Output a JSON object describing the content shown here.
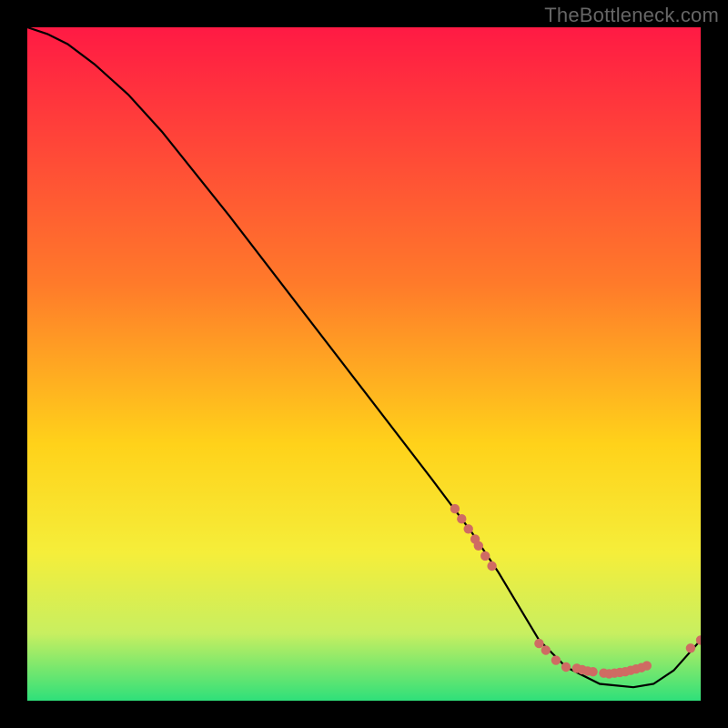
{
  "watermark": "TheBottleneck.com",
  "chart_data": {
    "type": "line",
    "title": "",
    "xlabel": "",
    "ylabel": "",
    "xlim": [
      0,
      100
    ],
    "ylim": [
      0,
      100
    ],
    "grid": false,
    "background_gradient": {
      "stops": [
        {
          "offset": 0.0,
          "color": "#ff1a44"
        },
        {
          "offset": 0.38,
          "color": "#ff7a2a"
        },
        {
          "offset": 0.62,
          "color": "#ffd21a"
        },
        {
          "offset": 0.78,
          "color": "#f5ee3a"
        },
        {
          "offset": 0.9,
          "color": "#c8ef60"
        },
        {
          "offset": 1.0,
          "color": "#2fe07a"
        }
      ]
    },
    "curve": {
      "x": [
        0,
        3,
        6,
        10,
        15,
        20,
        30,
        40,
        50,
        60,
        66,
        70,
        73,
        76,
        80,
        85,
        90,
        93,
        96,
        100
      ],
      "y": [
        100,
        99,
        97.5,
        94.5,
        90,
        84.5,
        72,
        59,
        46,
        33,
        25,
        19,
        14,
        9,
        5,
        2.5,
        2,
        2.5,
        4.5,
        9
      ]
    },
    "markers_cluster_a": {
      "color": "#cf6b63",
      "points": [
        {
          "x": 63.5,
          "y": 28.5
        },
        {
          "x": 64.5,
          "y": 27.0
        },
        {
          "x": 65.5,
          "y": 25.5
        },
        {
          "x": 66.5,
          "y": 24.0
        },
        {
          "x": 67.0,
          "y": 23.0
        },
        {
          "x": 68.0,
          "y": 21.5
        },
        {
          "x": 69.0,
          "y": 20.0
        }
      ]
    },
    "markers_cluster_b": {
      "color": "#cf6b63",
      "points": [
        {
          "x": 76.0,
          "y": 8.5
        },
        {
          "x": 77.0,
          "y": 7.5
        },
        {
          "x": 78.5,
          "y": 6.0
        },
        {
          "x": 80.0,
          "y": 5.0
        },
        {
          "x": 81.6,
          "y": 4.8
        },
        {
          "x": 82.4,
          "y": 4.6
        },
        {
          "x": 83.2,
          "y": 4.4
        },
        {
          "x": 84.0,
          "y": 4.3
        },
        {
          "x": 85.6,
          "y": 4.1
        },
        {
          "x": 86.4,
          "y": 4.0
        },
        {
          "x": 87.2,
          "y": 4.1
        },
        {
          "x": 88.0,
          "y": 4.2
        },
        {
          "x": 88.8,
          "y": 4.3
        },
        {
          "x": 89.6,
          "y": 4.5
        },
        {
          "x": 90.4,
          "y": 4.7
        },
        {
          "x": 91.2,
          "y": 4.9
        },
        {
          "x": 92.0,
          "y": 5.2
        }
      ]
    },
    "markers_cluster_c": {
      "color": "#cf6b63",
      "points": [
        {
          "x": 98.5,
          "y": 7.8
        },
        {
          "x": 100.0,
          "y": 9.0
        }
      ]
    },
    "small_label": {
      "text": "",
      "x": 84,
      "y": 5
    }
  }
}
